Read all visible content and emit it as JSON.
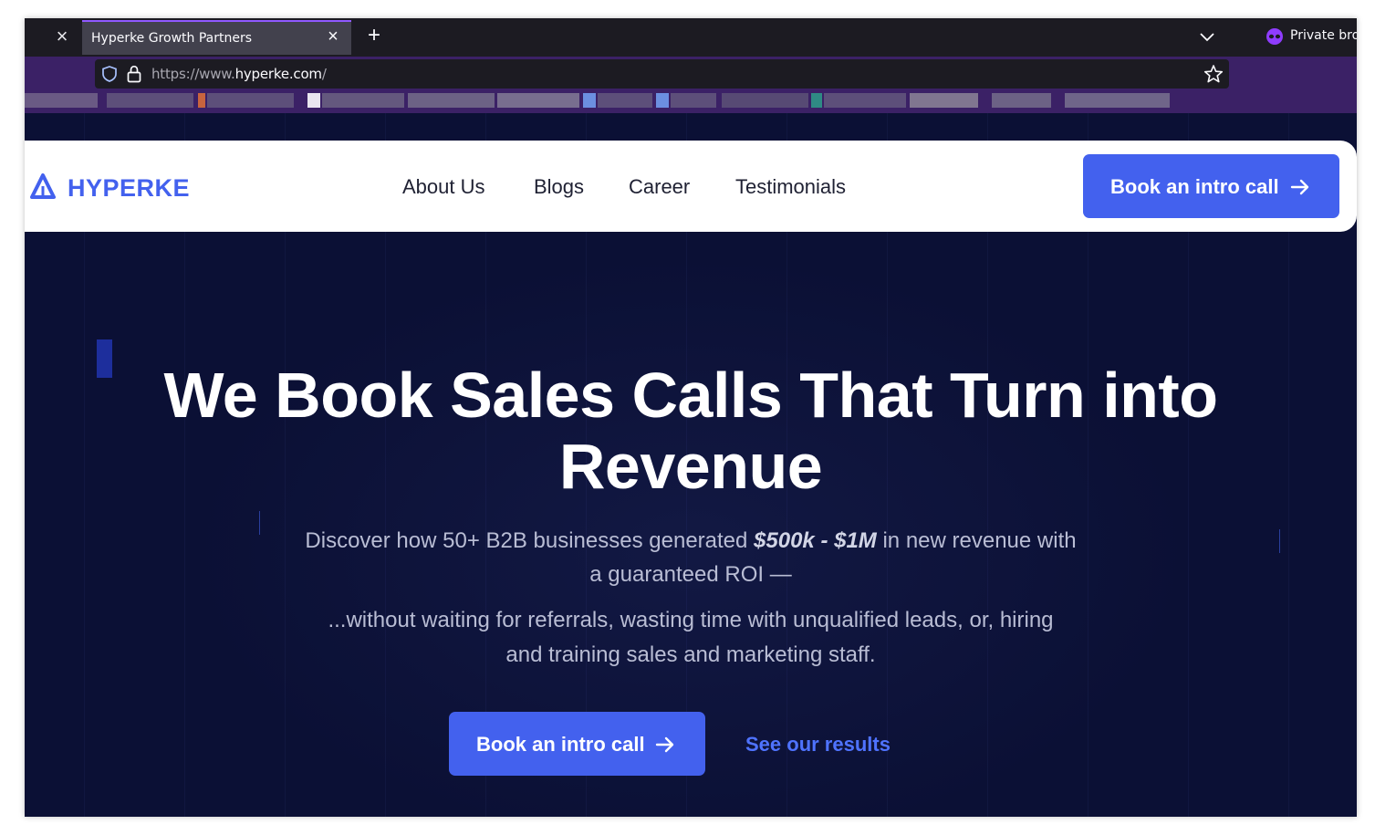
{
  "browser": {
    "tab_title": "Hyperke Growth Partners",
    "new_tab_glyph": "+",
    "close_glyph": "×",
    "private_label": "Private bro",
    "url_prefix": "https://www.",
    "url_domain": "hyperke.com",
    "url_suffix": "/",
    "accent_color": "#9059ff"
  },
  "header": {
    "logo_text": "HYPERKE",
    "nav": [
      {
        "label": "About Us"
      },
      {
        "label": "Blogs"
      },
      {
        "label": "Career"
      },
      {
        "label": "Testimonials"
      }
    ],
    "cta_label": "Book an intro call",
    "brand_color": "#4361ee"
  },
  "hero": {
    "title_line1": "We Book Sales Calls That Turn into",
    "title_line2": "Revenue",
    "sub_part1": "Discover how 50+ B2B businesses generated ",
    "sub_emphasis": "$500k - $1M",
    "sub_part2": " in new revenue with a guaranteed ROI —",
    "sub2": "...without waiting for referrals, wasting time with unqualified leads, or, hiring and training sales and marketing staff.",
    "cta_label": "Book an intro call",
    "secondary_label": "See our results"
  },
  "icons": {
    "arrow": "arrow-right-icon",
    "lock": "lock-icon",
    "shield": "shield-icon",
    "star": "star-icon",
    "private": "private-mask-icon"
  }
}
